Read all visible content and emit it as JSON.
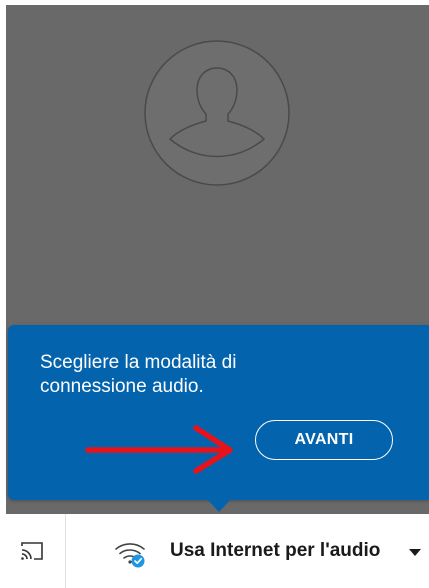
{
  "coachmark": {
    "message": "Scegliere la modalità di connessione audio.",
    "next_button_label": "AVANTI"
  },
  "audio_bar": {
    "audio_option_label": "Usa Internet per l'audio"
  },
  "icons": {
    "avatar": "avatar-silhouette-icon",
    "cast": "cast-icon",
    "wifi": "wifi-icon",
    "check_badge": "check-badge-icon",
    "dropdown": "chevron-down-icon"
  },
  "colors": {
    "coachmark_bg": "#0463ad",
    "video_bg": "#696969",
    "annotation_arrow": "#e8131a",
    "badge": "#1e96e6"
  }
}
